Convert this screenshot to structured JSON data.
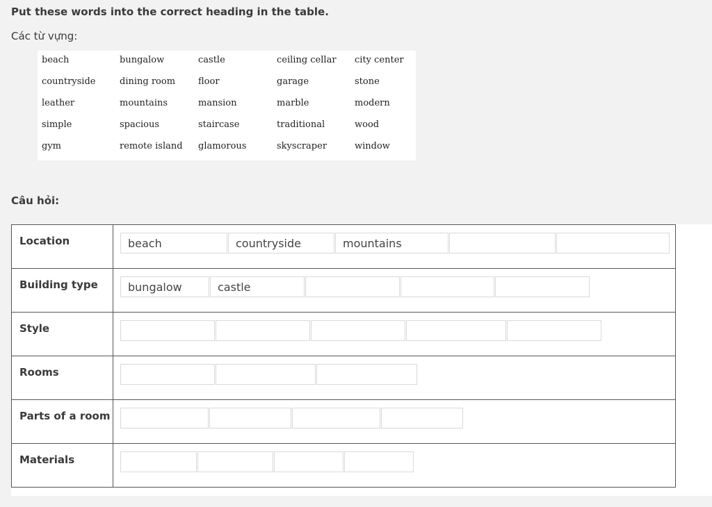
{
  "instruction": "Put these words into the correct heading in the table.",
  "vocab_title": "Các từ vựng:",
  "vocab_words": [
    "beach",
    "bungalow",
    "castle",
    "ceiling cellar",
    "city center",
    "countryside",
    "dining room",
    "floor",
    "garage",
    "stone",
    "leather",
    "mountains",
    "mansion",
    "marble",
    "modern",
    "simple",
    "spacious",
    "staircase",
    "traditional",
    "wood",
    "gym",
    "remote island",
    "glamorous",
    "skyscraper",
    "window"
  ],
  "question_title": "Câu hỏi:",
  "rows": [
    {
      "heading": "Location",
      "answers": [
        "beach",
        "countryside",
        "mountains",
        "",
        ""
      ]
    },
    {
      "heading": "Building type",
      "answers": [
        "bungalow",
        "castle",
        "",
        "",
        ""
      ]
    },
    {
      "heading": "Style",
      "answers": [
        "",
        "",
        "",
        "",
        ""
      ]
    },
    {
      "heading": "Rooms",
      "answers": [
        "",
        "",
        ""
      ]
    },
    {
      "heading": "Parts of a room",
      "answers": [
        "",
        "",
        "",
        ""
      ]
    },
    {
      "heading": "Materials",
      "answers": [
        "",
        "",
        "",
        ""
      ]
    }
  ]
}
